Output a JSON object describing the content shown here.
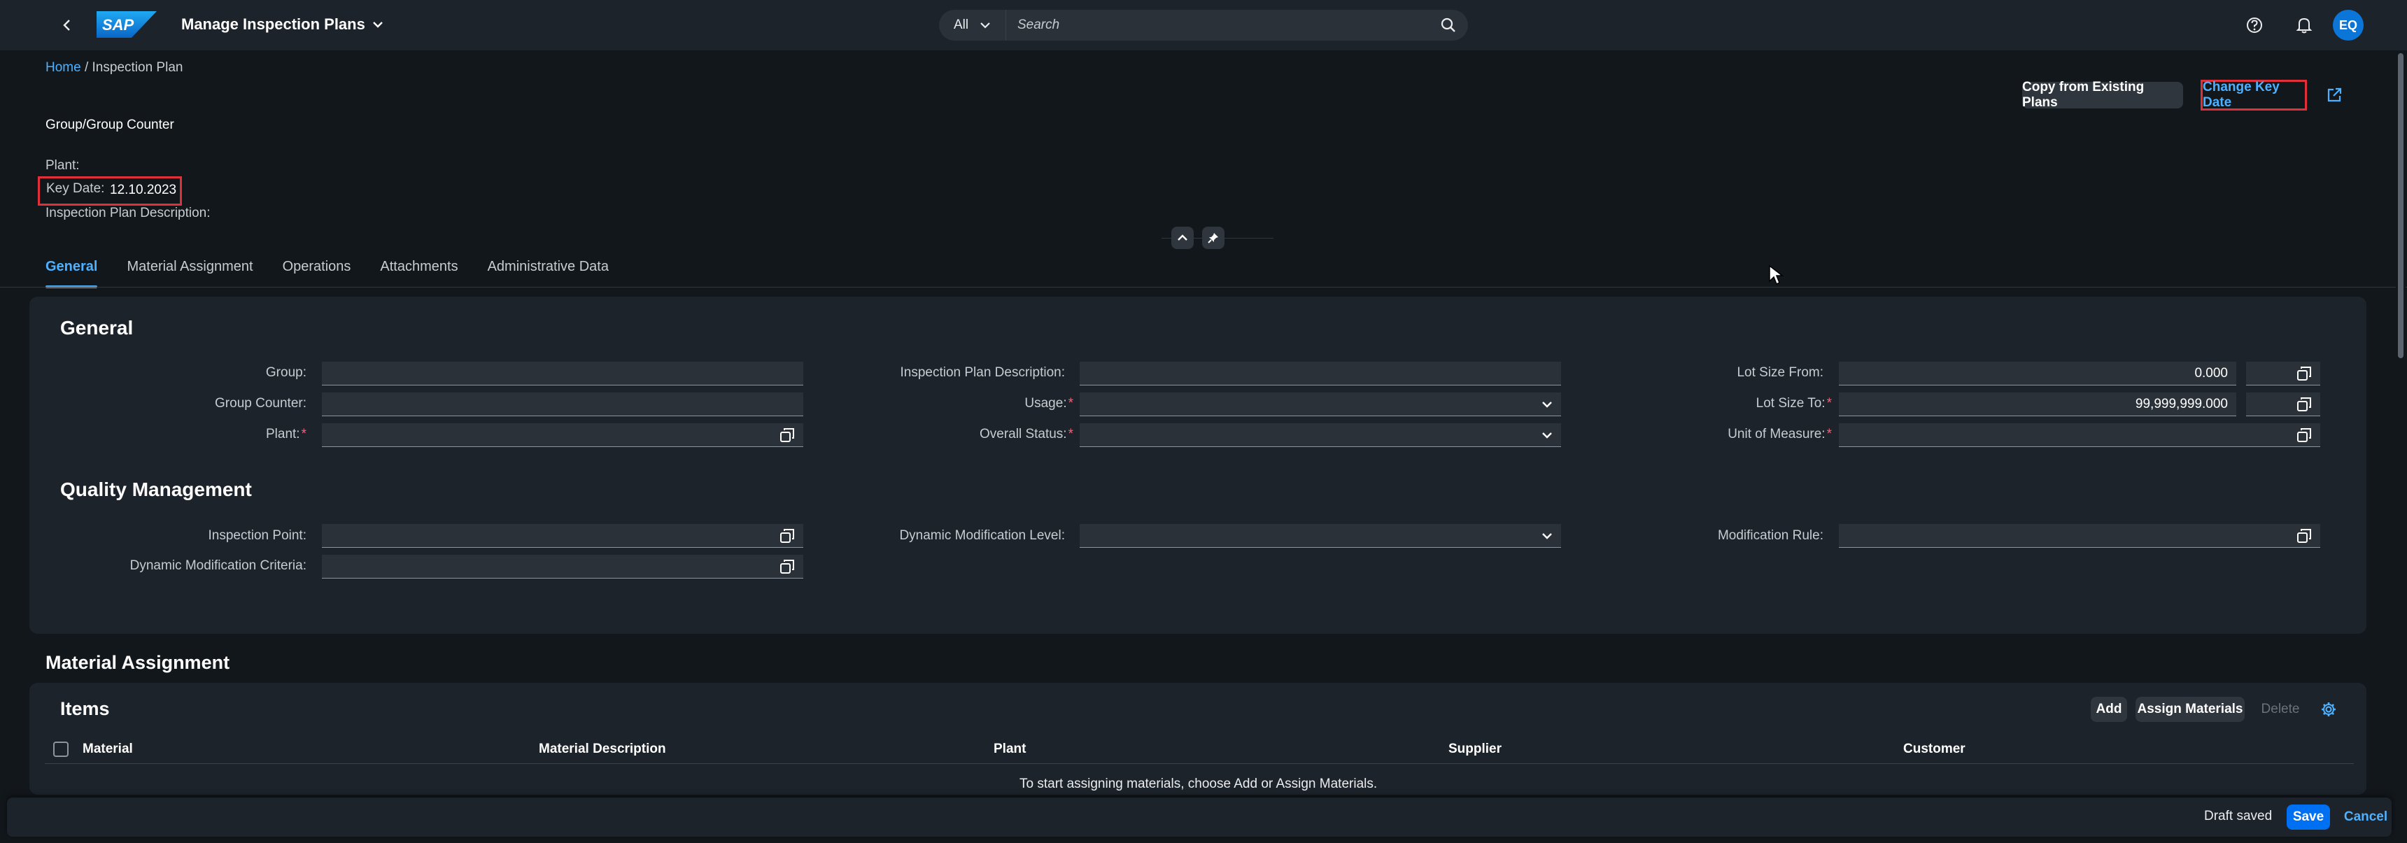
{
  "shell": {
    "app_title": "Manage Inspection Plans",
    "logo_text": "SAP",
    "search_scope": "All",
    "search_placeholder": "Search",
    "avatar_initials": "EQ"
  },
  "breadcrumb": {
    "home": "Home",
    "separator": " / ",
    "current": "Inspection Plan"
  },
  "header": {
    "copy_button": "Copy from Existing Plans",
    "change_key_date_button": "Change Key Date",
    "group_counter_label": "Group/Group Counter",
    "plant_label": "Plant:",
    "key_date_label": "Key Date:",
    "key_date_value": "12.10.2023",
    "description_label": "Inspection Plan Description:"
  },
  "tabs": [
    "General",
    "Material Assignment",
    "Operations",
    "Attachments",
    "Administrative Data"
  ],
  "general": {
    "title": "General",
    "group_label": "Group:",
    "group_counter_label": "Group Counter:",
    "plant_label": "Plant:",
    "description_label": "Inspection Plan Description:",
    "usage_label": "Usage:",
    "overall_status_label": "Overall Status:",
    "lot_size_from_label": "Lot Size From:",
    "lot_size_from_value": "0.000",
    "lot_size_to_label": "Lot Size To:",
    "lot_size_to_value": "99,999,999.000",
    "uom_label": "Unit of Measure:"
  },
  "quality": {
    "title": "Quality Management",
    "inspection_point_label": "Inspection Point:",
    "dyn_mod_criteria_label": "Dynamic Modification Criteria:",
    "dyn_mod_level_label": "Dynamic Modification Level:",
    "mod_rule_label": "Modification Rule:"
  },
  "material_assignment": {
    "section_title": "Material Assignment",
    "items_title": "Items",
    "add_button": "Add",
    "assign_button": "Assign Materials",
    "delete_button": "Delete",
    "columns": [
      "Material",
      "Material Description",
      "Plant",
      "Supplier",
      "Customer"
    ],
    "empty_message": "To start assigning materials, choose Add or Assign Materials."
  },
  "footer": {
    "status": "Draft saved",
    "save": "Save",
    "cancel": "Cancel"
  }
}
